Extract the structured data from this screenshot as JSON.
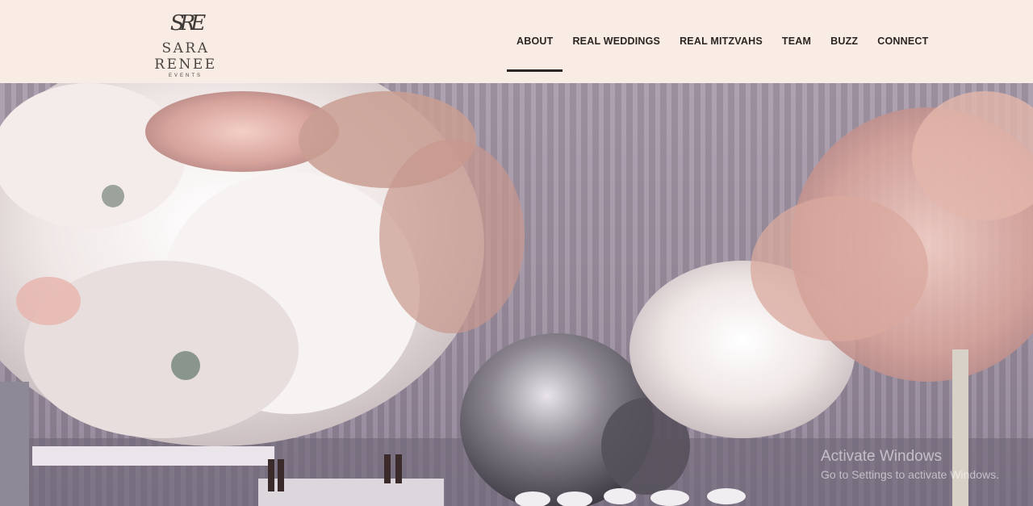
{
  "brand": {
    "monogram": "SRE",
    "name": "SARA RENEE",
    "tagline": "EVENTS"
  },
  "nav": {
    "items": [
      {
        "label": "ABOUT",
        "active": true
      },
      {
        "label": "REAL WEDDINGS",
        "active": false
      },
      {
        "label": "REAL MITZVAHS",
        "active": false
      },
      {
        "label": "TEAM",
        "active": false
      },
      {
        "label": "BUZZ",
        "active": false
      },
      {
        "label": "CONNECT",
        "active": false
      }
    ]
  },
  "hero": {
    "image": "floral-event-decor-photo"
  },
  "os_watermark": {
    "title": "Activate Windows",
    "subtitle": "Go to Settings to activate Windows."
  }
}
